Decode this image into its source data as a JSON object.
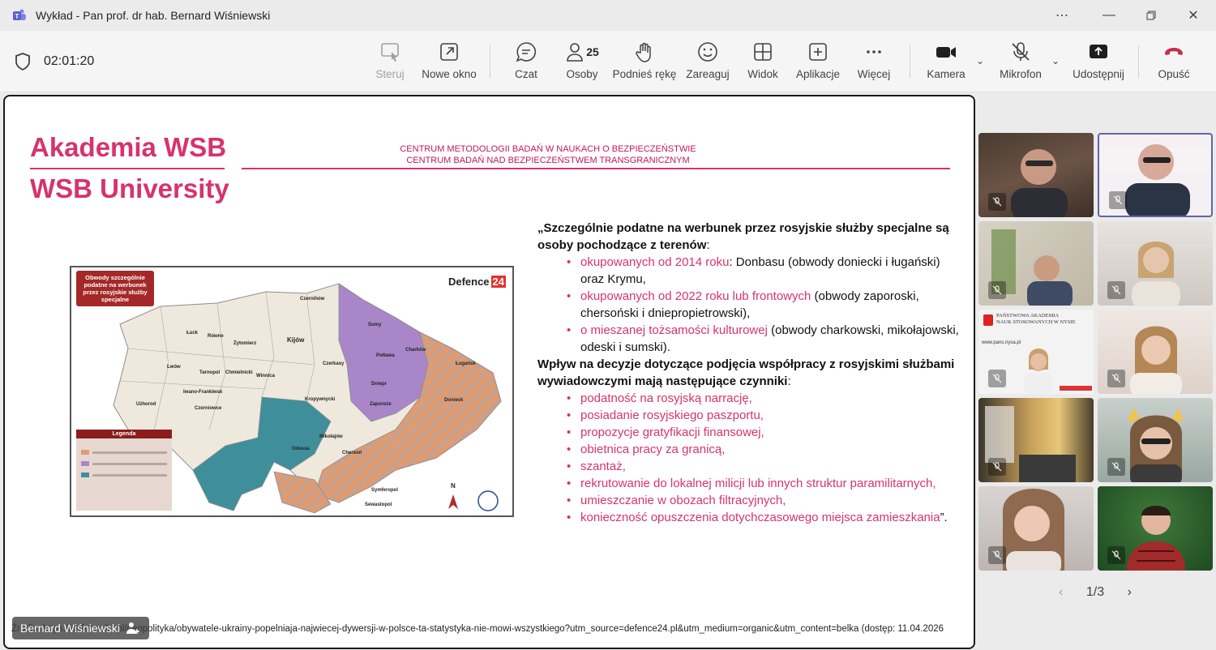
{
  "window": {
    "title": "Wykład - Pan prof. dr hab. Bernard Wiśniewski"
  },
  "meeting": {
    "timer": "02:01:20"
  },
  "toolbar": {
    "control": "Steruj",
    "new_window": "Nowe okno",
    "chat": "Czat",
    "people": "Osoby",
    "people_count": "25",
    "raise_hand": "Podnieś rękę",
    "react": "Zareaguj",
    "view": "Widok",
    "apps": "Aplikacje",
    "more": "Więcej",
    "camera": "Kamera",
    "mic": "Mikrofon",
    "share": "Udostępnij",
    "leave": "Opuść"
  },
  "slide": {
    "brand_pl": "Akademia WSB",
    "brand_en": "WSB University",
    "center1": "CENTRUM METODOLOGII BADAŃ W NAUKACH O BEZPIECZEŃSTWIE",
    "center2": "CENTRUM BADAŃ NAD BEZPIECZEŃSTWEM TRANSGRANICZNYM",
    "map": {
      "badge": "Obwody szczególnie podatne na werbunek przez rosyjskie służby specjalne",
      "logo_a": "Defence",
      "logo_b": "24",
      "legend_title": "Legenda",
      "compass": "N",
      "cities": [
        "Czernihów",
        "Łuck",
        "Równe",
        "Żytomierz",
        "Kijów",
        "Sumy",
        "Charków",
        "Połtawa",
        "Lwów",
        "Tarnopol",
        "Chmielnicki",
        "Winnica",
        "Czerkasy",
        "Iwano-Frankiwsk",
        "Czerniowce",
        "Użhorod",
        "Kropywnycki",
        "Dniepr",
        "Zaporoże",
        "Ługańsk",
        "Donieck",
        "Mikołajów",
        "Odessa",
        "Chersoń",
        "Symferopol",
        "Sewastopol"
      ]
    },
    "intro": "„Szczególnie podatne na werbunek przez rosyjskie służby specjalne są osoby pochodzące z terenów",
    "intro_tail": ":",
    "list1": [
      {
        "hl": "okupowanych od 2014 roku",
        "rest": ": Donbasu (obwody doniecki i ługański) oraz Krymu,"
      },
      {
        "hl": "okupowanych od 2022 roku lub frontowych",
        "rest": " (obwody zaporoski, chersoński i dniepropietrowski),"
      },
      {
        "hl": "o mieszanej tożsamości kulturowej",
        "rest": " (obwody charkowski, mikołajowski, odeski i sumski)."
      }
    ],
    "intro2": "Wpływ na decyzje dotyczące podjęcia współpracy z rosyjskimi służbami wywiadowczymi mają następujące czynniki",
    "intro2_tail": ":",
    "list2": [
      "podatność na rosyjską narrację,",
      "posiadanie rosyjskiego paszportu,",
      "propozycje gratyfikacji finansowej,",
      "obietnica pracy za granicą,",
      "szantaż,",
      "rekrutowanie do lokalnej milicji lub innych struktur paramilitarnych,",
      "umieszczanie w obozach filtracyjnych,",
      "konieczność opuszczenia dotychczasowego miejsca zamieszkania"
    ],
    "closing": "”.",
    "source": "Źródło: https://defence24.pl/geopolityka/obywatele-ukrainy-popelniaja-najwiecej-dywersji-w-polsce-ta-statystyka-nie-mowi-wszystkiego?utm_source=defence24.pl&utm_medium=organic&utm_content=belka (dostęp: 11.04.2026"
  },
  "presenter": {
    "name": "Bernard Wiśniewski"
  },
  "gallery": {
    "tile3_line1": "PAŃSTWOWA AKADEMIA",
    "tile3_line2": "NAUK STOSOWANYCH W NYSIE",
    "tile3_url": "www.pans.nysa.pl",
    "pager": "1/3"
  }
}
